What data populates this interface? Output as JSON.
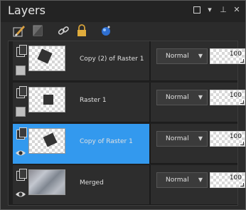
{
  "window": {
    "title": "Layers",
    "buttons": [
      "maximize-icon",
      "dropdown-icon",
      "pin-icon",
      "close-icon"
    ]
  },
  "toolbar": {
    "icons": [
      "brush-icon",
      "mask-icon",
      "link-icon",
      "lock-icon",
      "sphere-icon"
    ]
  },
  "layers": [
    {
      "name": "Copy (2) of Raster 1",
      "blend": "Normal",
      "opacity": "100",
      "selected": false,
      "visible_eye": false,
      "thumb": "rotated-square"
    },
    {
      "name": "Raster 1",
      "blend": "Normal",
      "opacity": "100",
      "selected": false,
      "visible_eye": false,
      "thumb": "square"
    },
    {
      "name": "Copy of Raster 1",
      "blend": "Normal",
      "opacity": "100",
      "selected": true,
      "visible_eye": true,
      "thumb": "rotated-square"
    },
    {
      "name": "Merged",
      "blend": "Normal",
      "opacity": "100",
      "selected": false,
      "visible_eye": true,
      "thumb": "merged"
    }
  ],
  "colors": {
    "selection": "#3399ee",
    "panel_bg": "#2b2b2b",
    "text": "#e0e0e0"
  }
}
